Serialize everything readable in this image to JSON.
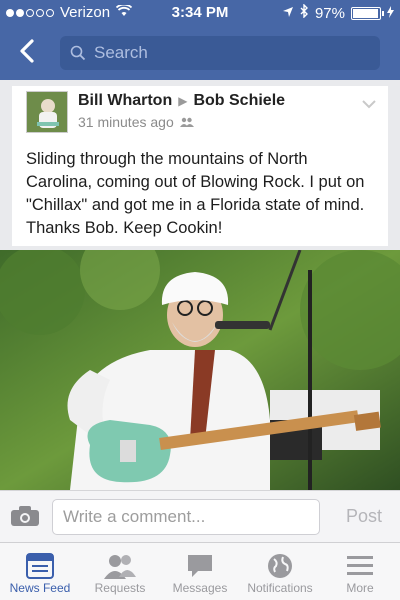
{
  "status_bar": {
    "carrier": "Verizon",
    "time": "3:34 PM",
    "battery": "97%",
    "battery_level": 0.97,
    "signal_bars": 2
  },
  "nav": {
    "search_placeholder": "Search"
  },
  "post": {
    "author": "Bill Wharton",
    "recipient": "Bob Schiele",
    "timestamp": "31 minutes ago",
    "text": "Sliding through the mountains of North Carolina, coming out of Blowing Rock. I put on \"Chillax\" and got me in a Florida state of mind. Thanks Bob. Keep Cookin!"
  },
  "comment": {
    "placeholder": "Write a comment...",
    "post_label": "Post"
  },
  "tabs": [
    {
      "label": "News Feed",
      "icon": "news-feed-icon",
      "active": true
    },
    {
      "label": "Requests",
      "icon": "friend-requests-icon",
      "active": false
    },
    {
      "label": "Messages",
      "icon": "messages-icon",
      "active": false
    },
    {
      "label": "Notifications",
      "icon": "globe-icon",
      "active": false
    },
    {
      "label": "More",
      "icon": "menu-icon",
      "active": false
    }
  ],
  "colors": {
    "brand": "#4767a6",
    "tab_active": "#3b5fac"
  }
}
